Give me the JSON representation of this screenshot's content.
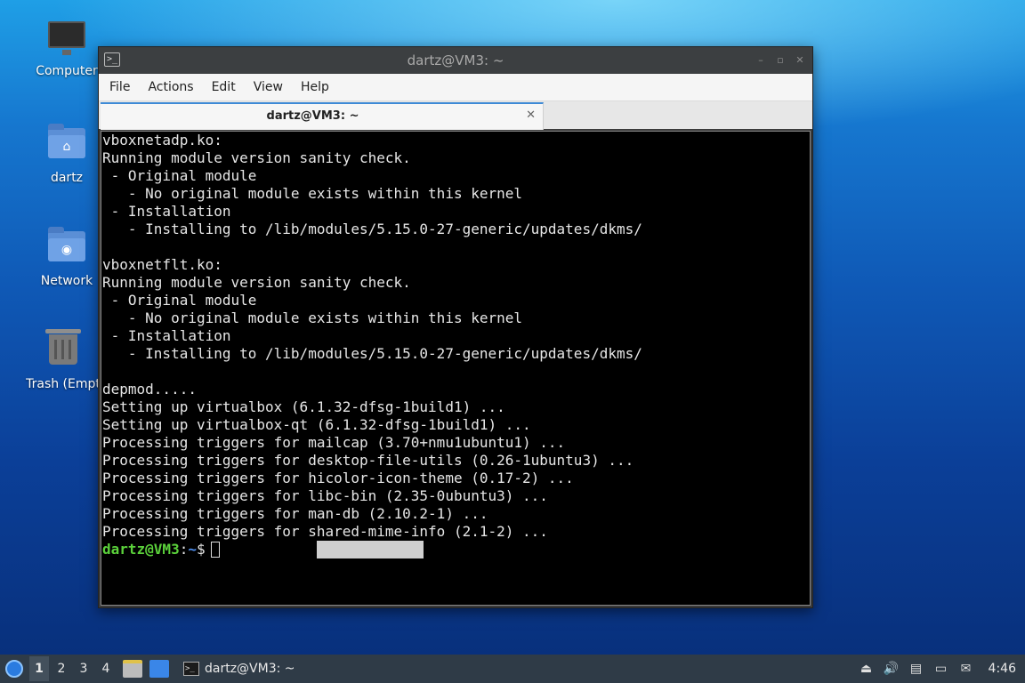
{
  "desktop": {
    "icons": [
      {
        "label": "Computer"
      },
      {
        "label": "dartz"
      },
      {
        "label": "Network"
      },
      {
        "label": "Trash (Empt"
      }
    ]
  },
  "window": {
    "title": "dartz@VM3: ~",
    "icon_glyph": ">_",
    "controls": [
      "–",
      "▫",
      "✕"
    ],
    "menu": [
      "File",
      "Actions",
      "Edit",
      "View",
      "Help"
    ],
    "tab": {
      "title": "dartz@VM3: ~",
      "close": "✕"
    },
    "terminal": {
      "lines": [
        "vboxnetadp.ko:",
        "Running module version sanity check.",
        " - Original module",
        "   - No original module exists within this kernel",
        " - Installation",
        "   - Installing to /lib/modules/5.15.0-27-generic/updates/dkms/",
        "",
        "vboxnetflt.ko:",
        "Running module version sanity check.",
        " - Original module",
        "   - No original module exists within this kernel",
        " - Installation",
        "   - Installing to /lib/modules/5.15.0-27-generic/updates/dkms/",
        "",
        "depmod.....",
        "Setting up virtualbox (6.1.32-dfsg-1build1) ...",
        "Setting up virtualbox-qt (6.1.32-dfsg-1build1) ...",
        "Processing triggers for mailcap (3.70+nmu1ubuntu1) ...",
        "Processing triggers for desktop-file-utils (0.26-1ubuntu3) ...",
        "Processing triggers for hicolor-icon-theme (0.17-2) ...",
        "Processing triggers for libc-bin (2.35-0ubuntu3) ...",
        "Processing triggers for man-db (2.10.2-1) ...",
        "Processing triggers for shared-mime-info (2.1-2) ..."
      ],
      "prompt": {
        "user_host": "dartz@VM3",
        "sep": ":",
        "path": "~",
        "symbol": "$"
      }
    }
  },
  "taskbar": {
    "workspaces": [
      "1",
      "2",
      "3",
      "4"
    ],
    "active_workspace": "1",
    "task": {
      "label": "dartz@VM3: ~",
      "icon_glyph": ">_"
    },
    "clock": "4:46"
  }
}
